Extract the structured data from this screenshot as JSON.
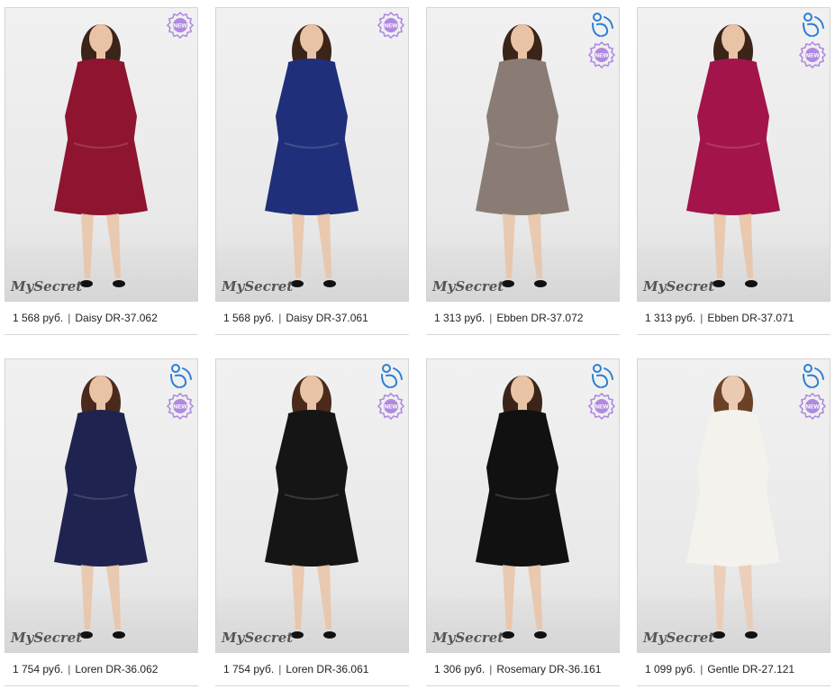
{
  "brand_logo": "MySecret",
  "separator": "|",
  "colors": {
    "badge": "#b08ae0",
    "pregnancy_icon": "#2c7fd4",
    "caption_text": "#222222"
  },
  "products": [
    {
      "price": "1 568 руб.",
      "name": "Daisy DR-37.062",
      "dress_color": "#8f1430",
      "skin": "#e9c3a6",
      "hair": "#3b2418",
      "badge_new": true,
      "badge_pregnancy": false
    },
    {
      "price": "1 568 руб.",
      "name": "Daisy DR-37.061",
      "dress_color": "#1f2f7a",
      "skin": "#e9c3a6",
      "hair": "#3b2418",
      "badge_new": true,
      "badge_pregnancy": false
    },
    {
      "price": "1 313 руб.",
      "name": "Ebben DR-37.072",
      "dress_color": "#8a7c74",
      "skin": "#e9c3a6",
      "hair": "#3b2418",
      "badge_new": true,
      "badge_pregnancy": true
    },
    {
      "price": "1 313 руб.",
      "name": "Ebben DR-37.071",
      "dress_color": "#a3144a",
      "skin": "#e9c3a6",
      "hair": "#3b2418",
      "badge_new": true,
      "badge_pregnancy": true
    },
    {
      "price": "1 754 руб.",
      "name": "Loren DR-36.062",
      "dress_color": "#1e2350",
      "skin": "#e9c3a6",
      "hair": "#4a2a1a",
      "badge_new": true,
      "badge_pregnancy": true
    },
    {
      "price": "1 754 руб.",
      "name": "Loren DR-36.061",
      "dress_color": "#151515",
      "skin": "#e9c3a6",
      "hair": "#4a2a1a",
      "badge_new": true,
      "badge_pregnancy": true
    },
    {
      "price": "1 306 руб.",
      "name": "Rosemary DR-36.161",
      "dress_color": "#111111",
      "skin": "#e9c3a6",
      "hair": "#3b2418",
      "badge_new": true,
      "badge_pregnancy": true
    },
    {
      "price": "1 099 руб.",
      "name": "Gentle DR-27.121",
      "dress_color": "#f4f2ec",
      "skin": "#eccab1",
      "hair": "#6b4226",
      "badge_new": true,
      "badge_pregnancy": true
    }
  ]
}
